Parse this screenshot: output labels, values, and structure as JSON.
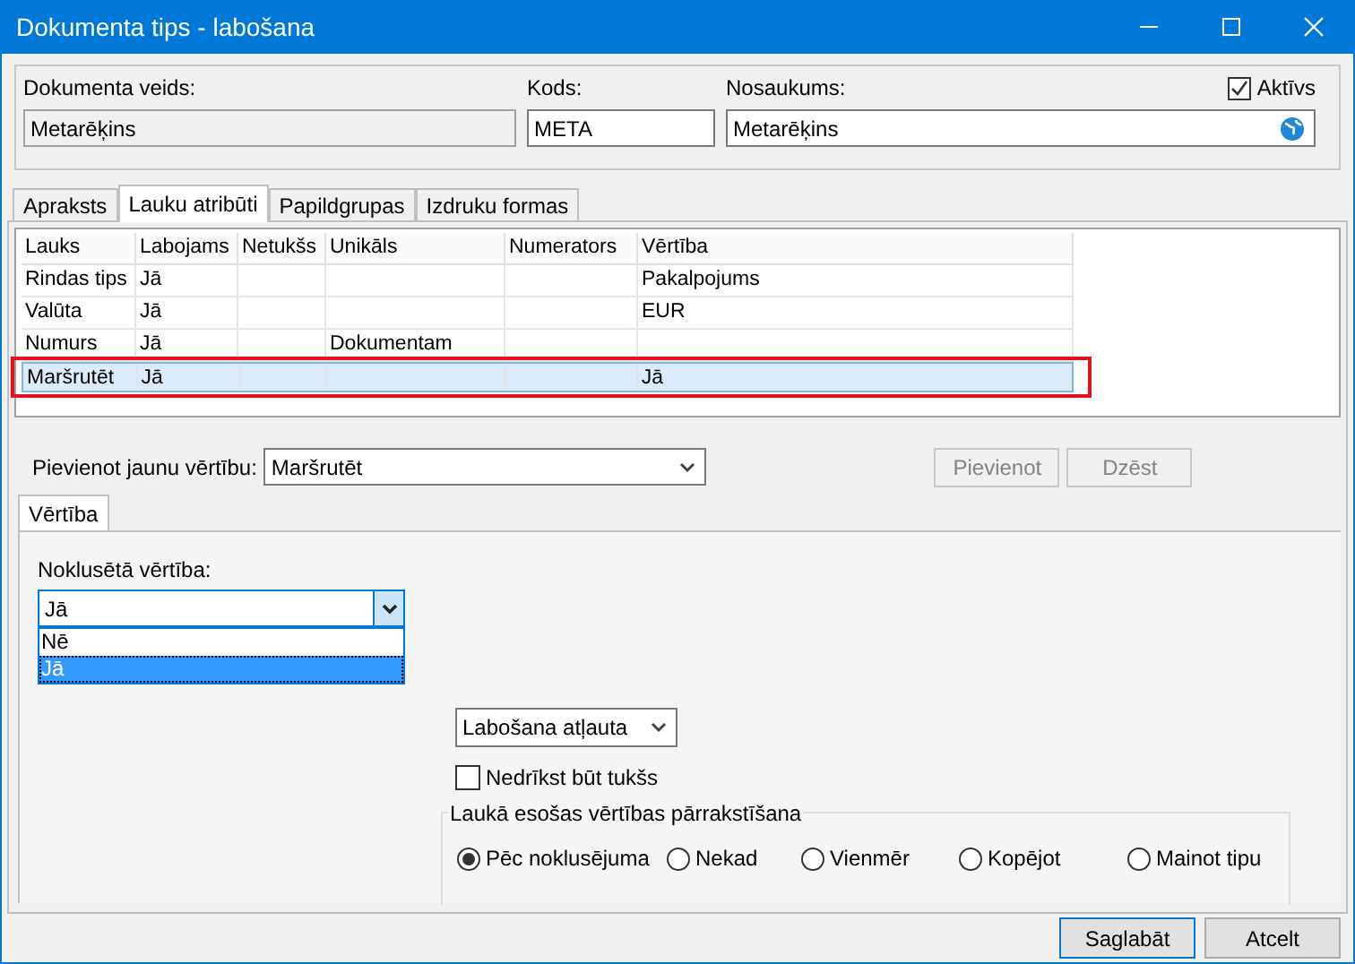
{
  "window": {
    "title": "Dokumenta tips - labošana"
  },
  "header": {
    "doc_type": {
      "label": "Dokumenta veids:",
      "value": "Metarēķins",
      "disabled": true
    },
    "code": {
      "label": "Kods:",
      "value": "META"
    },
    "name": {
      "label": "Nosaukums:",
      "value": "Metarēķins"
    },
    "active": {
      "label": "Aktīvs",
      "checked": true
    }
  },
  "tabs": [
    {
      "label": "Apraksts",
      "selected": false
    },
    {
      "label": "Lauku atribūti",
      "selected": true
    },
    {
      "label": "Papildgrupas",
      "selected": false
    },
    {
      "label": "Izdruku formas",
      "selected": false
    }
  ],
  "grid": {
    "columns": [
      "Lauks",
      "Labojams",
      "Netukšs",
      "Unikāls",
      "Numerators",
      "Vērtība"
    ],
    "rows": [
      {
        "cells": [
          "Rindas tips",
          "Jā",
          "",
          "",
          "",
          "Pakalpojums"
        ],
        "selected": false,
        "highlighted": false
      },
      {
        "cells": [
          "Valūta",
          "Jā",
          "",
          "",
          "",
          "EUR"
        ],
        "selected": false,
        "highlighted": false
      },
      {
        "cells": [
          "Numurs",
          "Jā",
          "",
          "Dokumentam",
          "",
          ""
        ],
        "selected": false,
        "highlighted": false
      },
      {
        "cells": [
          "Maršrutēt",
          "Jā",
          "",
          "",
          "",
          "Jā"
        ],
        "selected": true,
        "highlighted": true
      }
    ]
  },
  "add_value": {
    "label": "Pievienot jaunu vērtību:",
    "value": "Maršrutēt",
    "buttons": [
      {
        "label": "Pievienot",
        "disabled": true
      },
      {
        "label": "Dzēst",
        "disabled": true
      }
    ]
  },
  "value_tabs": [
    {
      "label": "Vērtība",
      "selected": true
    }
  ],
  "default_value": {
    "label": "Noklusētā vērtība:",
    "value": "Jā",
    "options": [
      {
        "label": "Nē",
        "selected": false
      },
      {
        "label": "Jā",
        "selected": true
      }
    ]
  },
  "edit_mode": {
    "value": "Labošana atļauta"
  },
  "not_empty": {
    "label": "Nedrīkst būt tukšs",
    "checked": false
  },
  "overwrite": {
    "title": "Laukā esošas vērtības pārrakstīšana",
    "options": [
      {
        "label": "Pēc noklusējuma",
        "selected": true
      },
      {
        "label": "Nekad",
        "selected": false
      },
      {
        "label": "Vienmēr",
        "selected": false
      },
      {
        "label": "Kopējot",
        "selected": false
      },
      {
        "label": "Mainot tipu",
        "selected": false
      }
    ]
  },
  "buttons": [
    {
      "label": "Saglabāt",
      "default": true
    },
    {
      "label": "Atcelt",
      "default": false
    }
  ]
}
